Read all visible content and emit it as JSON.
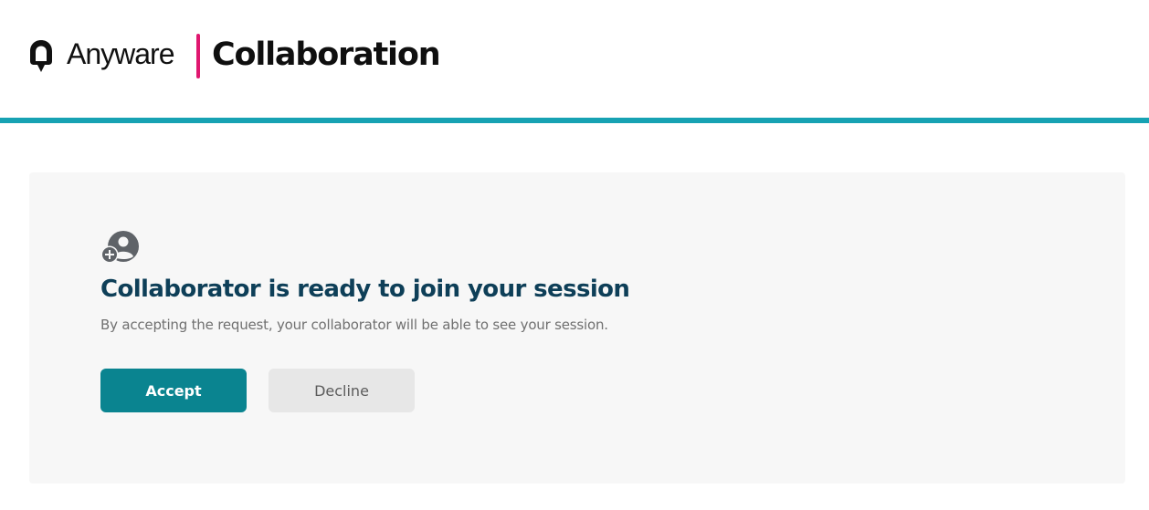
{
  "header": {
    "brand_name": "Anyware",
    "app_title": "Collaboration",
    "logo_icon": "anyware-logo-icon",
    "divider_color": "#e0176f",
    "accent_color": "#17a2b3"
  },
  "panel": {
    "icon": "add-user-icon",
    "heading": "Collaborator is ready to join your session",
    "description": "By accepting the request, your collaborator will be able to see your session.",
    "heading_color": "#0e3f58"
  },
  "actions": {
    "accept_label": "Accept",
    "decline_label": "Decline",
    "accept_color": "#0a8490",
    "decline_color": "#e7e7e7"
  }
}
